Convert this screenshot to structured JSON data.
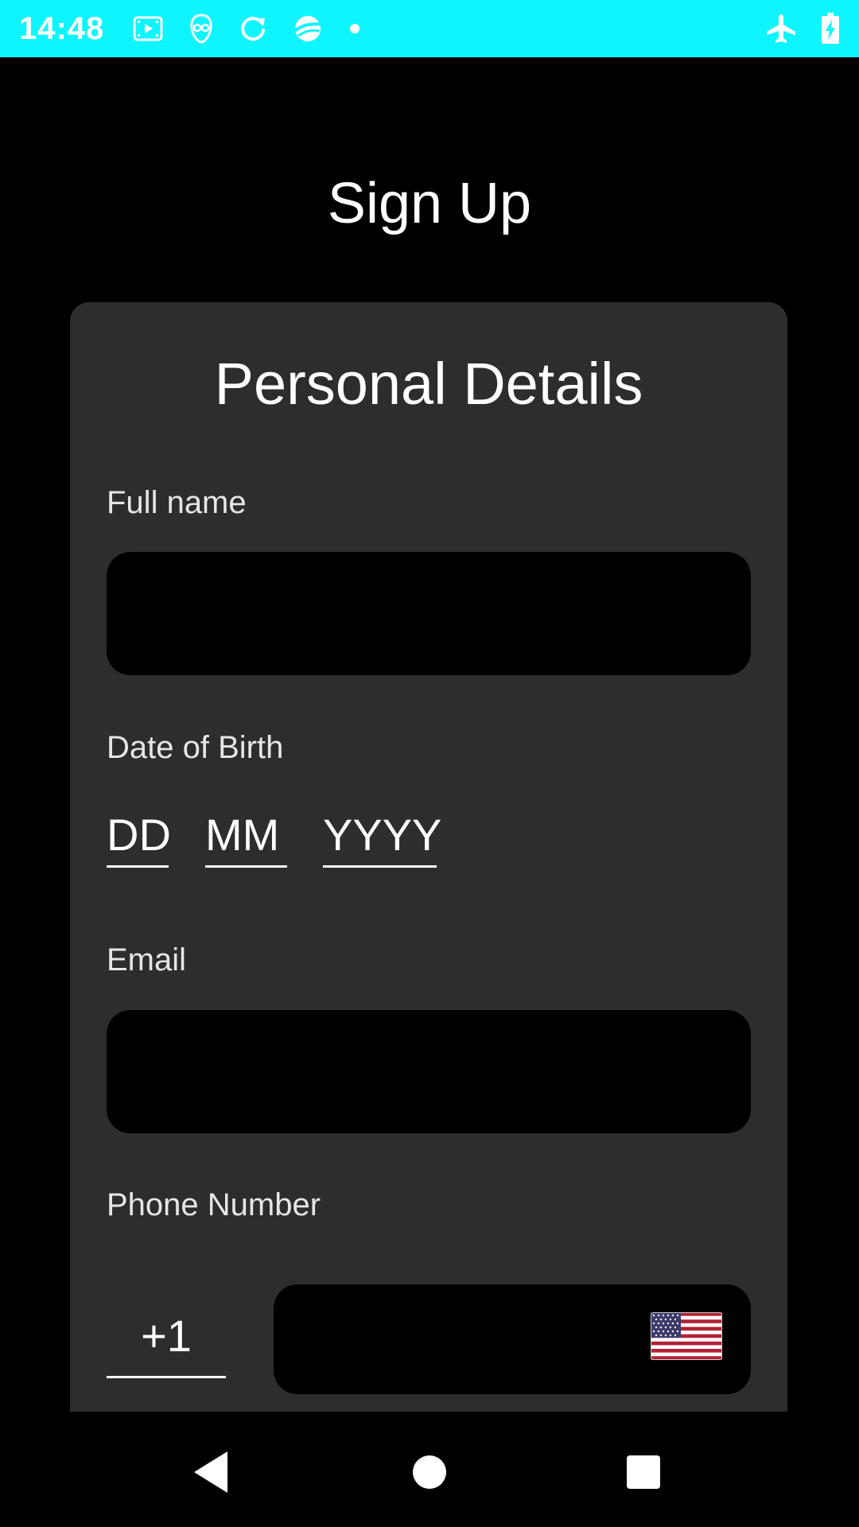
{
  "status_bar": {
    "time": "14:48",
    "background": "#0ff5ff",
    "icons_left": [
      "media-icon",
      "alien-icon",
      "sync-icon",
      "planet-icon",
      "dot-icon"
    ],
    "icons_right": [
      "airplane-mode-icon",
      "battery-charging-icon"
    ]
  },
  "page": {
    "title": "Sign Up"
  },
  "card": {
    "title": "Personal Details",
    "background": "#2d2d2d"
  },
  "form": {
    "full_name_label": "Full name",
    "full_name_value": "",
    "dob_label": "Date of Birth",
    "dob_day_placeholder": "DD",
    "dob_month_placeholder": "MM",
    "dob_year_placeholder": "YYYY",
    "email_label": "Email",
    "email_value": "",
    "phone_label": "Phone Number",
    "country_code": "+1",
    "phone_value": "",
    "flag_icon": "us-flag-icon"
  },
  "nav_bar": {
    "buttons": [
      "back-icon",
      "home-icon",
      "recents-icon"
    ]
  }
}
